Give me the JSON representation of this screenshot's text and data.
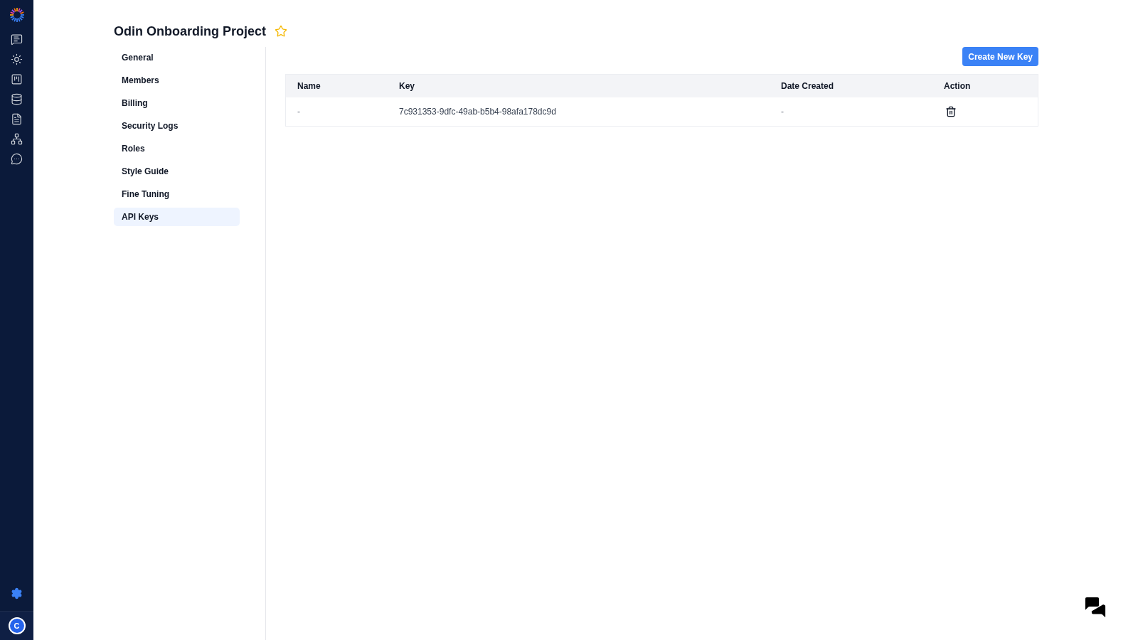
{
  "rail": {
    "avatar": "C"
  },
  "project": {
    "title": "Odin Onboarding Project"
  },
  "menu": [
    {
      "label": "General",
      "selected": false
    },
    {
      "label": "Members",
      "selected": false
    },
    {
      "label": "Billing",
      "selected": false
    },
    {
      "label": "Security Logs",
      "selected": false
    },
    {
      "label": "Roles",
      "selected": false
    },
    {
      "label": "Style Guide",
      "selected": false
    },
    {
      "label": "Fine Tuning",
      "selected": false
    },
    {
      "label": "API Keys",
      "selected": true
    }
  ],
  "create_button": "Create New Key",
  "table": {
    "columns": [
      "Name",
      "Key",
      "Date Created",
      "Action"
    ],
    "rows": [
      {
        "name": "-",
        "key": "7c931353-9dfc-49ab-b5b4-98afa178dc9d",
        "date_created": "-"
      }
    ]
  }
}
